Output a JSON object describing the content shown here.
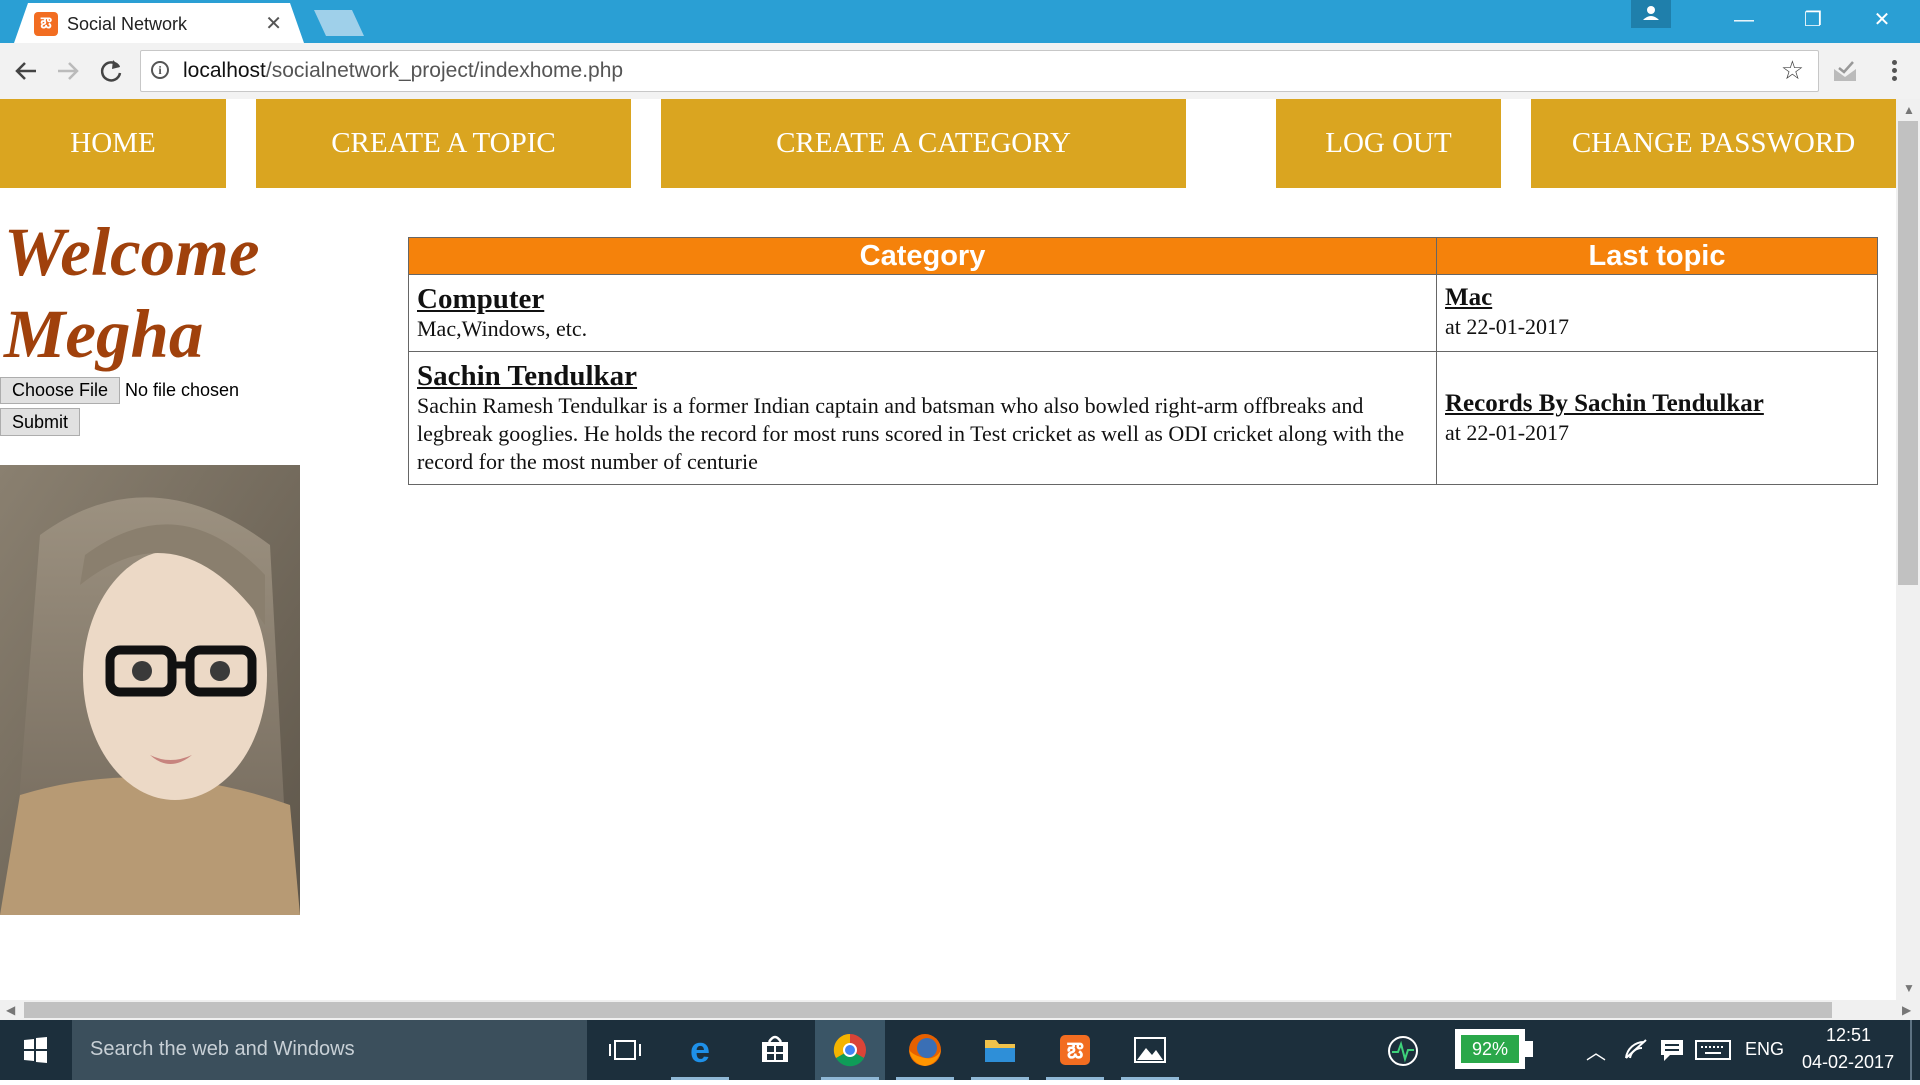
{
  "browser": {
    "tab_title": "Social Network",
    "favicon_glyph": "ఔ",
    "url_host": "localhost",
    "url_path": "/socialnetwork_project/indexhome.php"
  },
  "nav": {
    "home": "HOME",
    "create_topic": "CREATE A TOPIC",
    "create_category": "CREATE A CATEGORY",
    "logout": "LOG OUT",
    "change_password": "CHANGE PASSWORD"
  },
  "welcome": {
    "line1": "Welcome",
    "line2": "Megha"
  },
  "upload": {
    "choose_label": "Choose File",
    "status": "No file chosen",
    "submit_label": "Submit"
  },
  "table": {
    "headers": [
      "Category",
      "Last topic"
    ],
    "rows": [
      {
        "category": "Computer",
        "description": "Mac,Windows, etc.",
        "last_topic": "Mac",
        "last_topic_date": "at 22-01-2017"
      },
      {
        "category": "Sachin Tendulkar",
        "description": "Sachin Ramesh Tendulkar is a former Indian captain and batsman who also bowled right-arm offbreaks and legbreak googlies. He holds the record for most runs scored in Test cricket as well as ODI cricket along with the record for the most number of centurie",
        "last_topic": "Records By Sachin Tendulkar",
        "last_topic_date": "at 22-01-2017"
      }
    ]
  },
  "taskbar": {
    "search_placeholder": "Search the web and Windows",
    "battery": "92%",
    "language": "ENG",
    "time": "12:51",
    "date": "04-02-2017"
  },
  "colors": {
    "nav_bg": "#daa520",
    "table_header_bg": "#f5820b",
    "welcome_text": "#a0410c",
    "chrome_frame": "#2a9fd4"
  }
}
